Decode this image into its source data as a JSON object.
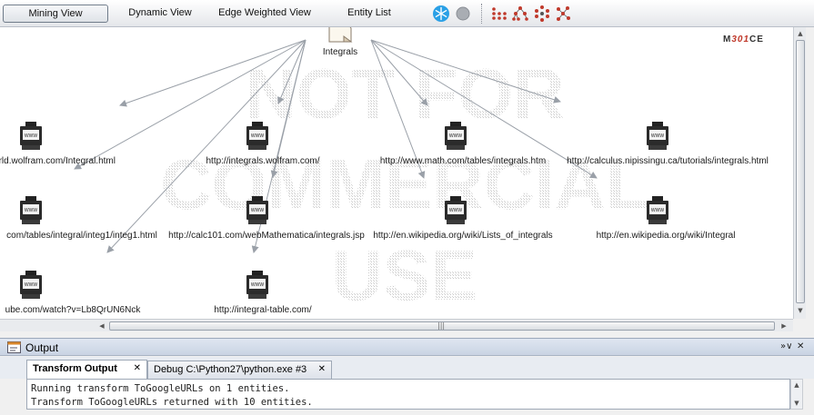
{
  "toolbar": {
    "tabs": [
      {
        "label": "Mining View",
        "active": true
      },
      {
        "label": "Dynamic View",
        "active": false
      },
      {
        "label": "Edge Weighted View",
        "active": false
      },
      {
        "label": "Entity List",
        "active": false
      }
    ],
    "icons": [
      "snowflake-freeze-icon",
      "stop-icon",
      "block-layout-icon",
      "hierarchical-layout-icon",
      "circular-layout-icon",
      "organic-layout-icon"
    ]
  },
  "graph": {
    "brand": {
      "left": "M",
      "red": "301",
      "right": "CE"
    },
    "watermark_lines": [
      "NOT FOR",
      "COMMERCIAL",
      "USE"
    ],
    "root": {
      "label": "Integrals",
      "icon": "document-icon"
    },
    "nodes": [
      {
        "label": "orld.wolfram.com/Integral.html"
      },
      {
        "label": "http://integrals.wolfram.com/"
      },
      {
        "label": "http://www.math.com/tables/integrals.htm"
      },
      {
        "label": "http://calculus.nipissingu.ca/tutorials/integrals.html"
      },
      {
        "label": "com/tables/integral/integ1/integ1.html"
      },
      {
        "label": "http://calc101.com/webMathematica/integrals.jsp"
      },
      {
        "label": "http://en.wikipedia.org/wiki/Lists_of_integrals"
      },
      {
        "label": "http://en.wikipedia.org/wiki/Integral"
      },
      {
        "label": "ube.com/watch?v=Lb8QrUN6Nck"
      },
      {
        "label": "http://integral-table.com/"
      }
    ]
  },
  "output": {
    "title": "Output",
    "tabs": [
      {
        "label": "Transform Output",
        "active": true
      },
      {
        "label": "Debug C:\\Python27\\python.exe #3",
        "active": false
      }
    ],
    "console_lines": [
      "Running transform ToGoogleURLs on 1 entities.",
      "Transform ToGoogleURLs returned with 10 entities."
    ]
  },
  "colors": {
    "edge": "#9aa0a8",
    "icon_dark": "#222222",
    "freeze_blue": "#2aa0e6",
    "layout_red": "#c0392b"
  }
}
